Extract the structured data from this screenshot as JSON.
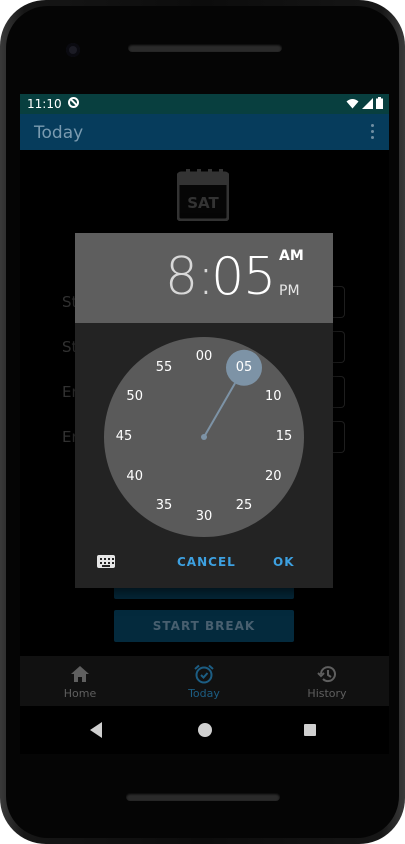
{
  "status_bar": {
    "time": "11:10"
  },
  "app_bar": {
    "title": "Today"
  },
  "calendar_icon": {
    "day": "SAT"
  },
  "background_rows": [
    {
      "label": "St"
    },
    {
      "label": "St"
    },
    {
      "label": "Er"
    },
    {
      "label": "Er"
    }
  ],
  "buttons": {
    "start_break": "START BREAK"
  },
  "time_picker": {
    "hour": "8",
    "separator": ":",
    "minute": "05",
    "am_label": "AM",
    "pm_label": "PM",
    "selected_period": "AM",
    "clock_numbers": [
      "00",
      "05",
      "10",
      "15",
      "20",
      "25",
      "30",
      "35",
      "40",
      "45",
      "50",
      "55"
    ],
    "selected_minute": "05",
    "cancel_label": "CANCEL",
    "ok_label": "OK"
  },
  "bottom_nav": {
    "items": [
      {
        "label": "Home",
        "icon": "home-icon",
        "active": false
      },
      {
        "label": "Today",
        "icon": "alarm-clock-icon",
        "active": true
      },
      {
        "label": "History",
        "icon": "history-icon",
        "active": false
      }
    ]
  },
  "colors": {
    "accent": "#3da0e0",
    "app_bar": "#063c5c",
    "status_bar": "#083f3f",
    "dialog_header": "#5e5e5e",
    "clock_face": "#5a5a5a",
    "selector": "#7d93a6"
  }
}
